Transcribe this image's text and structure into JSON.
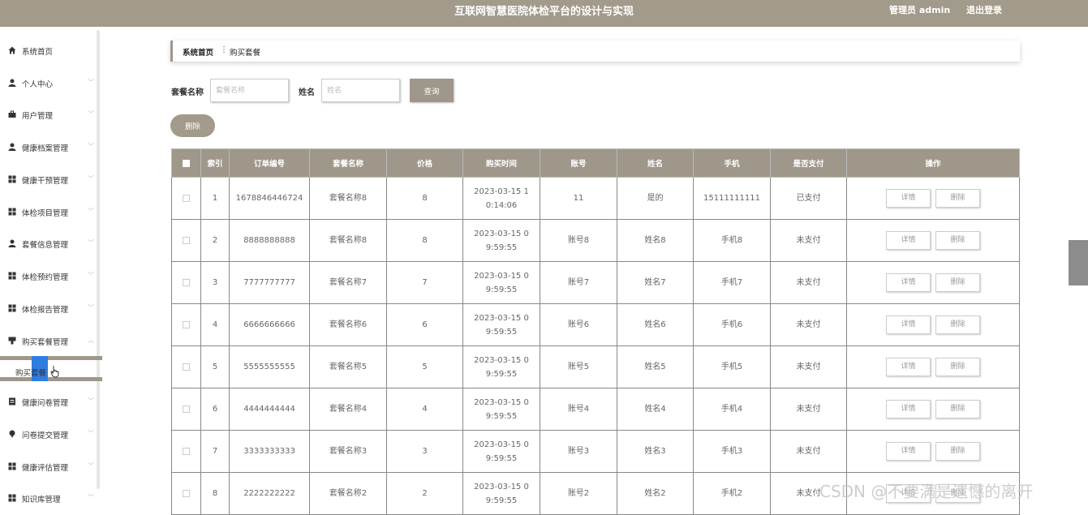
{
  "header": {
    "title": "互联网智慧医院体检平台的设计与实现",
    "user": "管理员 admin",
    "logout": "退出登录"
  },
  "sidebar": {
    "items": [
      {
        "label": "系统首页",
        "icon": "home-icon"
      },
      {
        "label": "个人中心",
        "icon": "user-icon"
      },
      {
        "label": "用户管理",
        "icon": "briefcase-icon"
      },
      {
        "label": "健康档案管理",
        "icon": "user-icon"
      },
      {
        "label": "健康干预管理",
        "icon": "grid-icon"
      },
      {
        "label": "体检项目管理",
        "icon": "grid-icon"
      },
      {
        "label": "套餐信息管理",
        "icon": "user-icon"
      },
      {
        "label": "体检预约管理",
        "icon": "grid-icon"
      },
      {
        "label": "体检报告管理",
        "icon": "grid-icon"
      },
      {
        "label": "购买套餐管理",
        "icon": "cup-icon"
      },
      {
        "label": "健康问卷管理",
        "icon": "document-icon"
      },
      {
        "label": "问卷提交管理",
        "icon": "pin-icon"
      },
      {
        "label": "健康评估管理",
        "icon": "grid-icon"
      },
      {
        "label": "知识库管理",
        "icon": "grid-icon"
      }
    ],
    "submenu": {
      "label": "购买套餐"
    }
  },
  "breadcrumb": {
    "home": "系统首页",
    "separator": "⋮",
    "current": "购买套餐"
  },
  "search": {
    "package_label": "套餐名称",
    "package_placeholder": "套餐名称",
    "name_label": "姓名",
    "name_placeholder": "姓名",
    "query_button": "查询",
    "delete_button": "删除"
  },
  "table": {
    "headers": [
      "索引",
      "订单编号",
      "套餐名称",
      "价格",
      "购买时间",
      "账号",
      "姓名",
      "手机",
      "是否支付",
      "操作"
    ],
    "detail_label": "详情",
    "delete_label": "删除",
    "rows": [
      {
        "index": "1",
        "order": "1678846446724",
        "package": "套餐名称8",
        "price": "8",
        "time": "2023-03-15 10:14:06",
        "account": "11",
        "name": "是的",
        "phone": "15111111111",
        "paid": "已支付"
      },
      {
        "index": "2",
        "order": "8888888888",
        "package": "套餐名称8",
        "price": "8",
        "time": "2023-03-15 09:59:55",
        "account": "账号8",
        "name": "姓名8",
        "phone": "手机8",
        "paid": "未支付"
      },
      {
        "index": "3",
        "order": "7777777777",
        "package": "套餐名称7",
        "price": "7",
        "time": "2023-03-15 09:59:55",
        "account": "账号7",
        "name": "姓名7",
        "phone": "手机7",
        "paid": "未支付"
      },
      {
        "index": "4",
        "order": "6666666666",
        "package": "套餐名称6",
        "price": "6",
        "time": "2023-03-15 09:59:55",
        "account": "账号6",
        "name": "姓名6",
        "phone": "手机6",
        "paid": "未支付"
      },
      {
        "index": "5",
        "order": "5555555555",
        "package": "套餐名称5",
        "price": "5",
        "time": "2023-03-15 09:59:55",
        "account": "账号5",
        "name": "姓名5",
        "phone": "手机5",
        "paid": "未支付"
      },
      {
        "index": "6",
        "order": "4444444444",
        "package": "套餐名称4",
        "price": "4",
        "time": "2023-03-15 09:59:55",
        "account": "账号4",
        "name": "姓名4",
        "phone": "手机4",
        "paid": "未支付"
      },
      {
        "index": "7",
        "order": "3333333333",
        "package": "套餐名称3",
        "price": "3",
        "time": "2023-03-15 09:59:55",
        "account": "账号3",
        "name": "姓名3",
        "phone": "手机3",
        "paid": "未支付"
      },
      {
        "index": "8",
        "order": "2222222222",
        "package": "套餐名称2",
        "price": "2",
        "time": "2023-03-15 09:59:55",
        "account": "账号2",
        "name": "姓名2",
        "phone": "手机2",
        "paid": "未支付"
      }
    ]
  },
  "watermark": "CSDN @不要满是遗憾的离开",
  "colors": {
    "accent": "#9e978a",
    "topbar": "#a29a8a"
  }
}
